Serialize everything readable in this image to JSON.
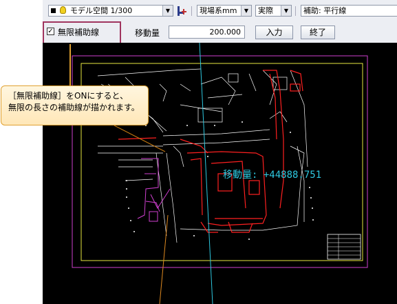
{
  "toolbar": {
    "space_select": "モデル空間 1/300",
    "units_select": "現場系mm",
    "scale_select": "実際",
    "assist_select": "補助: 平行線"
  },
  "assist_bar": {
    "infinite_checkbox_label": "無限補助線",
    "infinite_checked": true,
    "move_amount_label": "移動量",
    "move_amount_value": "200.000",
    "input_button": "入力",
    "finish_button": "終了"
  },
  "canvas": {
    "move_readout": "移動量: +44888.751"
  },
  "callout": {
    "line1": "［無限補助線］をONにすると、",
    "line2": "無限の長さの補助線が描かれます。"
  },
  "colors": {
    "highlight_border": "#a0345e",
    "callout_fill": "#ffecc4",
    "cad_background": "#000000"
  }
}
